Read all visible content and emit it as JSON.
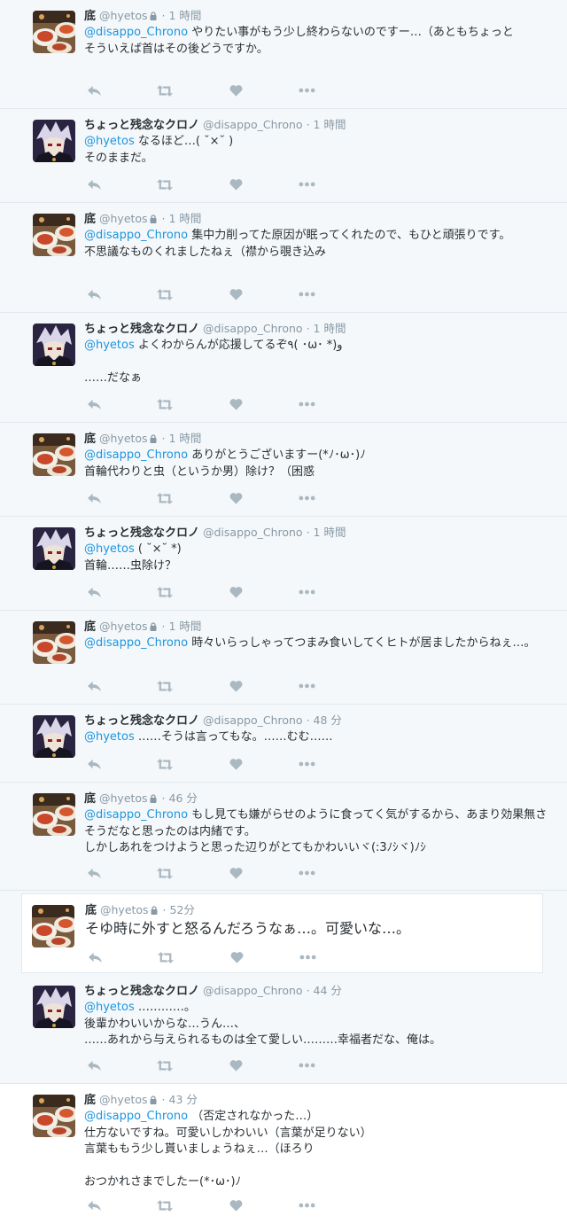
{
  "colors": {
    "link": "#1b95e0",
    "meta": "#8899a6",
    "text": "#292f33",
    "border": "#e1e8ed",
    "icon": "#aab8c2"
  },
  "users": {
    "hyetos": {
      "name": "底",
      "handle": "@hyetos",
      "locked": true,
      "avatar_icon": "food-plate-avatar"
    },
    "chrono": {
      "name": "ちょっと残念なクロノ",
      "handle": "@disappo_Chrono",
      "locked": false,
      "avatar_icon": "anime-character-avatar"
    }
  },
  "tweets": [
    {
      "user": "hyetos",
      "time": "1 時間",
      "mention": "@disappo_Chrono",
      "text": " やりたい事がもう少し終わらないのですー…（あともちょっと\nそういえば首はその後どうですか。"
    },
    {
      "user": "chrono",
      "time": "1 時間",
      "mention": "@hyetos",
      "text": " なるほど…( ˘×˘ )\nそのままだ。"
    },
    {
      "user": "hyetos",
      "time": "1 時間",
      "mention": "@disappo_Chrono",
      "text": " 集中力削ってた原因が眠ってくれたので、もひと頑張りです。\n不思議なものくれましたねぇ（襟から覗き込み"
    },
    {
      "user": "chrono",
      "time": "1 時間",
      "mention": "@hyetos",
      "text": " よくわからんが応援してるぞ٩( ･ω･ *)و\n\n……だなぁ"
    },
    {
      "user": "hyetos",
      "time": "1 時間",
      "mention": "@disappo_Chrono",
      "text": " ありがとうございますー(*ﾉ･ω･)ﾉ\n首輪代わりと虫（というか男）除け？（困惑"
    },
    {
      "user": "chrono",
      "time": "1 時間",
      "mention": "@hyetos",
      "text": " ( ˘×˘ *)\n首輪……虫除け？"
    },
    {
      "user": "hyetos",
      "time": "1 時間",
      "mention": "@disappo_Chrono",
      "text": " 時々いらっしゃってつまみ食いしてくヒトが居ましたからねぇ…。"
    },
    {
      "user": "chrono",
      "time": "48 分",
      "mention": "@hyetos",
      "text": " ……そうは言ってもな。……むむ……"
    },
    {
      "user": "hyetos",
      "time": "46 分",
      "mention": "@disappo_Chrono",
      "text": " もし見ても嫌がらせのように食ってく気がするから、あまり効果無さそうだなと思ったのは内緒です。\nしかしあれをつけようと思った辺りがとてもかわいいヾ(:3ﾉｼヾ)ﾉｼ"
    },
    {
      "user": "hyetos",
      "time": "52分",
      "mention": "",
      "text": "そゆ時に外すと怒るんだろうなぁ…。可愛いな…。"
    },
    {
      "user": "chrono",
      "time": "44 分",
      "mention": "@hyetos",
      "text": " …………。\n後輩かわいいからな…うん…、\n……あれから与えられるものは全て愛しい………幸福者だな、俺は。"
    },
    {
      "user": "hyetos",
      "time": "43 分",
      "mention": "@disappo_Chrono",
      "text": " （否定されなかった…）\n仕方ないですね。可愛いしかわいい（言葉が足りない）\n言葉ももう少し貰いましょうねぇ…（ほろり\n\nおつかれさまでしたー(*･ω･)ﾉ"
    }
  ],
  "actions": {
    "reply_icon": "reply-icon",
    "retweet_icon": "retweet-icon",
    "like_icon": "heart-icon",
    "more_icon": "more-icon"
  }
}
